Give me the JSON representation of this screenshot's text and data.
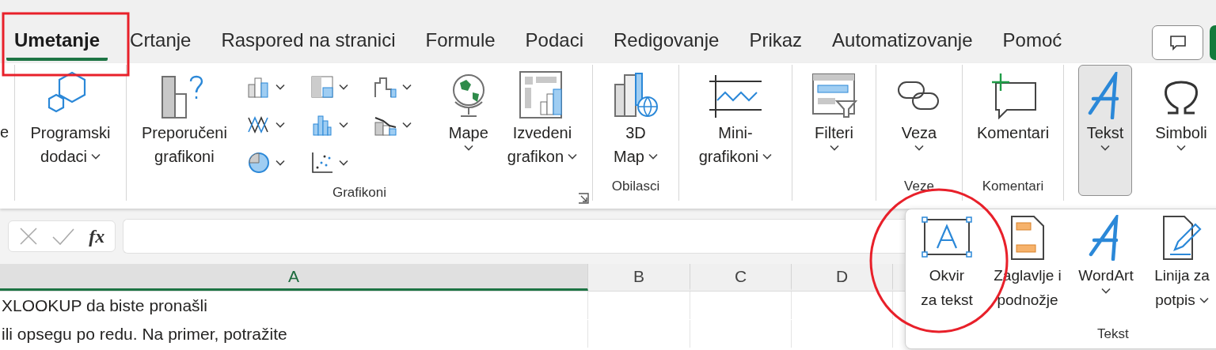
{
  "tabs": [
    {
      "label": "Umetanje",
      "selected": true
    },
    {
      "label": "Crtanje",
      "selected": false
    },
    {
      "label": "Raspored na stranici",
      "selected": false
    },
    {
      "label": "Formule",
      "selected": false
    },
    {
      "label": "Podaci",
      "selected": false
    },
    {
      "label": "Redigovanje",
      "selected": false
    },
    {
      "label": "Prikaz",
      "selected": false
    },
    {
      "label": "Automatizovanje",
      "selected": false
    },
    {
      "label": "Pomoć",
      "selected": false
    }
  ],
  "ribbon": {
    "leading_fragment": "e",
    "groups": [
      {
        "items": [
          {
            "kind": "large",
            "lines": [
              "Programski",
              "dodaci"
            ],
            "dropdown": true,
            "pressed": false
          }
        ]
      },
      {
        "label": "Grafikoni",
        "launcher": true,
        "items": [
          {
            "kind": "large",
            "lines": [
              "Preporučeni",
              "grafikoni"
            ],
            "dropdown": false,
            "pressed": false
          },
          {
            "kind": "gallery"
          },
          {
            "kind": "large",
            "lines": [
              "Mape"
            ],
            "dropdown": true,
            "pressed": false
          },
          {
            "kind": "large",
            "lines": [
              "Izvedeni",
              "grafikon"
            ],
            "dropdown": true,
            "pressed": false
          }
        ]
      },
      {
        "label": "Obilasci",
        "launcher": false,
        "items": [
          {
            "kind": "large",
            "lines": [
              "3D",
              "Map"
            ],
            "dropdown": true,
            "pressed": false
          }
        ]
      },
      {
        "items": [
          {
            "kind": "large",
            "lines": [
              "Mini-",
              "grafikoni"
            ],
            "dropdown": true,
            "pressed": false
          }
        ]
      },
      {
        "items": [
          {
            "kind": "large",
            "lines": [
              "Filteri"
            ],
            "dropdown": true,
            "pressed": false
          }
        ]
      },
      {
        "label": "Veze",
        "launcher": false,
        "items": [
          {
            "kind": "large",
            "lines": [
              "Veza"
            ],
            "dropdown": true,
            "pressed": false
          }
        ]
      },
      {
        "label": "Komentari",
        "launcher": false,
        "items": [
          {
            "kind": "large",
            "lines": [
              "Komentari"
            ],
            "dropdown": false,
            "pressed": false
          }
        ]
      },
      {
        "items": [
          {
            "kind": "large",
            "lines": [
              "Tekst"
            ],
            "dropdown": true,
            "pressed": true
          }
        ]
      },
      {
        "items": [
          {
            "kind": "large",
            "lines": [
              "Simboli"
            ],
            "dropdown": true,
            "pressed": false
          }
        ]
      }
    ]
  },
  "formula_bar": {
    "function_label": "fx"
  },
  "sheet": {
    "columns": [
      {
        "label": "A",
        "selected": true
      },
      {
        "label": "B",
        "selected": false
      },
      {
        "label": "C",
        "selected": false
      },
      {
        "label": "D",
        "selected": false
      }
    ],
    "rows": [
      [
        "XLOOKUP da biste pronašli"
      ],
      [
        "ili opsegu po redu. Na primer, potražite"
      ]
    ]
  },
  "text_menu": {
    "label": "Tekst",
    "items": [
      {
        "lines": [
          "Okvir",
          "za tekst"
        ],
        "dropdown": false
      },
      {
        "lines": [
          "Zaglavlje i",
          "podnožje"
        ],
        "dropdown": false
      },
      {
        "lines": [
          "WordArt"
        ],
        "dropdown": true
      },
      {
        "lines": [
          "Linija za",
          "potpis"
        ],
        "dropdown": true
      }
    ]
  }
}
